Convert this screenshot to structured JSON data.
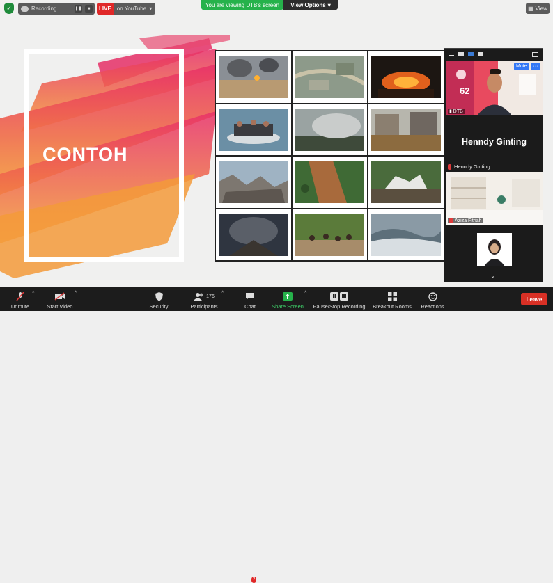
{
  "recording": {
    "label": "Recording...",
    "pause_icon": "pause-icon",
    "stop_icon": "stop-icon"
  },
  "live": {
    "badge": "LIVE",
    "label": "on YouTube"
  },
  "share_banner": {
    "text": "You are viewing DTB's screen",
    "view_options": "View Options"
  },
  "view_button": {
    "label": "View"
  },
  "slide": {
    "title": "CONTOH",
    "photos": [
      "airstrike-smoke-city",
      "satellite-flood-map",
      "night-fire",
      "refugee-boat",
      "forest-fire-smoke",
      "flooded-houses",
      "tsunami-debris",
      "landslide-aerial",
      "collapsed-building",
      "volcano-eruption",
      "crowd-riot",
      "tsunami-wave"
    ]
  },
  "gallery": {
    "main_tile": {
      "name": "DTB",
      "mute_label": "Mute",
      "more_label": "···",
      "badge_text": "62"
    },
    "speaker_name": "Henndy Ginting",
    "tile2_name": "Henndy Ginting",
    "tile3_name": "Aziza Fitriah"
  },
  "toolbar": {
    "unmute": "Unmute",
    "start_video": "Start Video",
    "security": "Security",
    "participants": "Participants",
    "participants_count": "176",
    "chat": "Chat",
    "chat_badge": "2",
    "share_screen": "Share Screen",
    "recording": "Pause/Stop Recording",
    "breakout": "Breakout Rooms",
    "reactions": "Reactions",
    "leave": "Leave"
  },
  "colors": {
    "accent_green": "#26b24b",
    "live_red": "#e02828",
    "leave_red": "#d93025",
    "zoom_blue": "#3478f6"
  }
}
